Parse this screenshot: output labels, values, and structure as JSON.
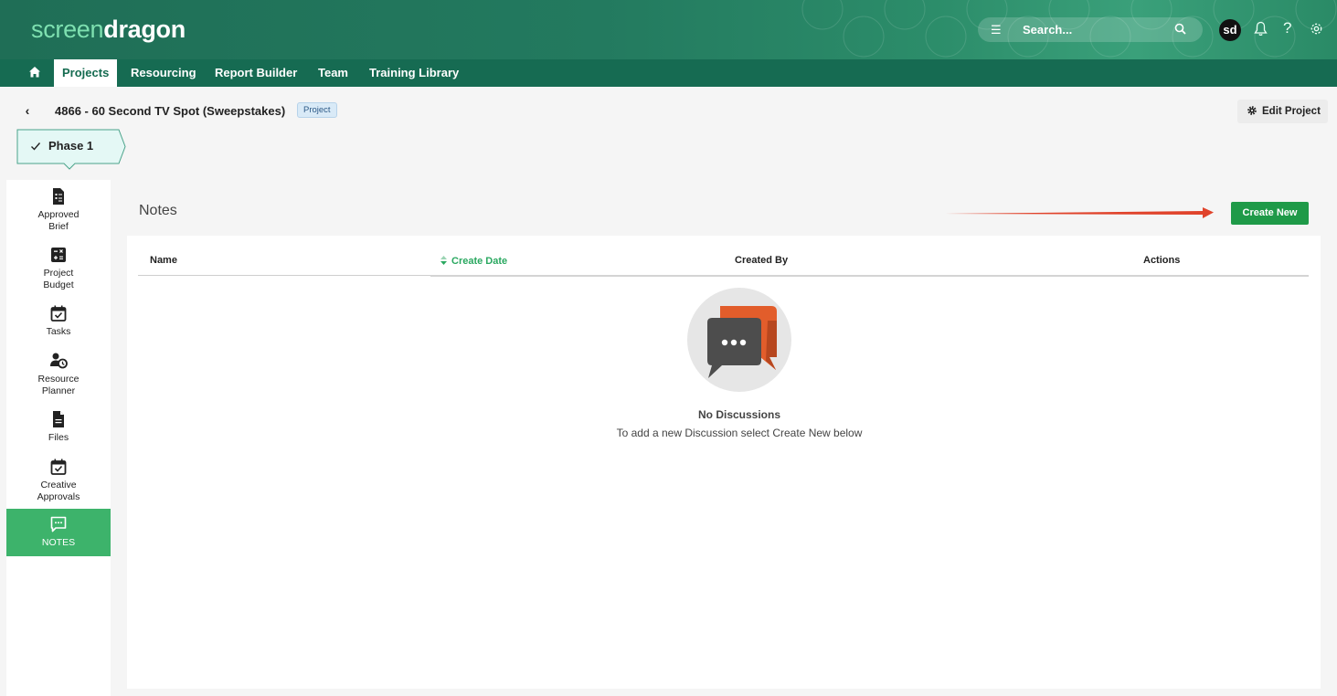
{
  "header": {
    "logo_light": "screen",
    "logo_bold": "dragon",
    "search_placeholder": "Search...",
    "avatar_initials": "sd",
    "icons": [
      "menu-icon",
      "search-icon",
      "bell-icon",
      "help-icon",
      "gear-icon"
    ]
  },
  "nav": {
    "items": [
      {
        "label": "Projects",
        "active": true
      },
      {
        "label": "Resourcing"
      },
      {
        "label": "Report Builder"
      },
      {
        "label": "Team"
      },
      {
        "label": "Training Library"
      }
    ]
  },
  "project": {
    "title": "4866 - 60 Second TV Spot (Sweepstakes)",
    "badge": "Project",
    "edit_label": "Edit Project",
    "phase_label": "Phase 1"
  },
  "sidebar": {
    "items": [
      {
        "line1": "Approved",
        "line2": "Brief"
      },
      {
        "line1": "Project",
        "line2": "Budget"
      },
      {
        "line1": "Tasks",
        "line2": ""
      },
      {
        "line1": "Resource",
        "line2": "Planner"
      },
      {
        "line1": "Files",
        "line2": ""
      },
      {
        "line1": "Creative",
        "line2": "Approvals"
      },
      {
        "line1": "NOTES",
        "line2": "",
        "active": true
      }
    ]
  },
  "notes": {
    "heading": "Notes",
    "create_label": "Create New",
    "columns": [
      "Name",
      "Create Date",
      "Created By",
      "Actions"
    ],
    "empty_title": "No Discussions",
    "empty_subtitle": "To add a new Discussion select Create New below"
  },
  "colors": {
    "brand_green": "#1f6e56",
    "accent_green": "#3db36b",
    "button_green": "#1f9a48",
    "annotation_arrow": "#e0432b"
  }
}
